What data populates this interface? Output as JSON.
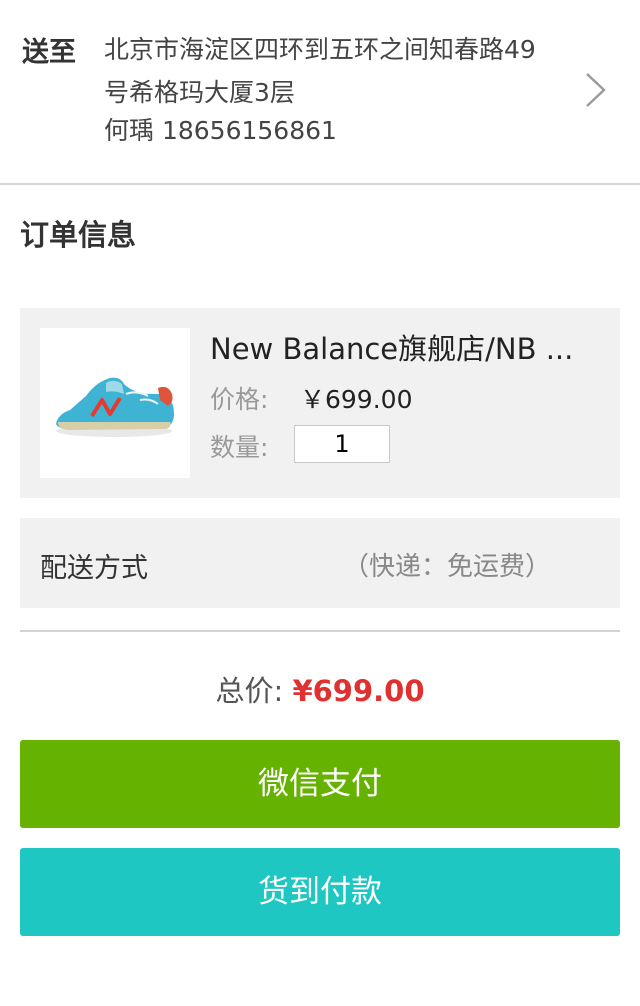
{
  "address": {
    "label": "送至",
    "line": "北京市海淀区四环到五环之间知春路49号希格玛大厦3层",
    "contact": "何瑀 18656156861"
  },
  "order": {
    "title": "订单信息",
    "product": {
      "name": "New Balance旗舰店/NB ...",
      "price_label": "价格:",
      "price": "￥699.00",
      "qty_label": "数量:",
      "qty": "1"
    },
    "delivery": {
      "label": "配送方式",
      "value": "（快递：免运费）"
    },
    "total": {
      "label": "总价:",
      "value": "¥699.00"
    }
  },
  "buttons": {
    "wechat_pay": "微信支付",
    "cash_on_delivery": "货到付款"
  },
  "colors": {
    "wechat_btn": "#66b200",
    "cod_btn": "#1ec7c2",
    "total_price": "#e0302f"
  }
}
